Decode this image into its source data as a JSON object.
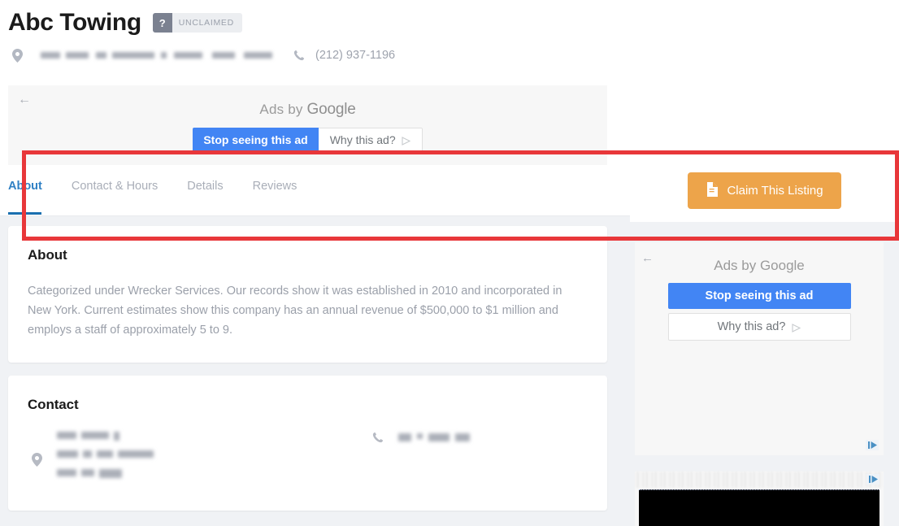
{
  "business": {
    "name": "Abc Towing",
    "badge": {
      "mark": "?",
      "label": "UNCLAIMED"
    },
    "address_redacted": "",
    "phone": "(212) 937-1196",
    "location_icon": "map-pin-icon",
    "phone_icon": "phone-icon"
  },
  "top_ad": {
    "back_arrow": "←",
    "ads_by_prefix": "Ads by ",
    "ads_by_brand": "Google",
    "stop_label": "Stop seeing this ad",
    "why_label": "Why this ad?",
    "adchoices_icon": "adchoices-icon",
    "blue": "#4285F4"
  },
  "tabs": [
    {
      "label": "About",
      "active": true
    },
    {
      "label": "Contact & Hours",
      "active": false
    },
    {
      "label": "Details",
      "active": false
    },
    {
      "label": "Reviews",
      "active": false
    }
  ],
  "about_card": {
    "title": "About",
    "body": "Categorized under Wrecker Services. Our records show it was established in 2010 and incorporated in New York. Current estimates show this company has an annual revenue of $500,000 to $1 million and employs a staff of approximately 5 to 9."
  },
  "contact_card": {
    "title": "Contact",
    "address_redacted": "",
    "phone_redacted": "",
    "location_icon": "map-pin-icon",
    "phone_icon": "phone-icon"
  },
  "claim": {
    "label": "Claim This Listing",
    "icon": "document-icon",
    "color": "#EDA44A",
    "highlight_color": "#E8373A"
  },
  "side_ad": {
    "back_arrow": "←",
    "ads_by_prefix": "Ads by ",
    "ads_by_brand": "Google",
    "stop_label": "Stop seeing this ad",
    "why_label": "Why this ad?",
    "adchoices_icon": "adchoices-icon"
  },
  "side_ad_2": {
    "adchoices_icon": "adchoices-icon"
  },
  "theme": {
    "page_bg": "#F0F2F5",
    "card_bg": "#FFFFFF",
    "tab_active": "#1A6FB0",
    "muted_text": "#9BA0AA"
  }
}
